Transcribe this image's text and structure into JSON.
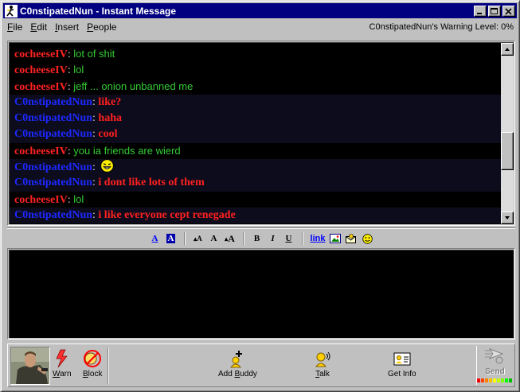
{
  "window": {
    "title": "C0nstipatedNun - Instant Message",
    "colors": {
      "titlebar": "#000080",
      "self_name": "#1e28ff",
      "other_name": "#ff2222",
      "other_text": "#33cc33",
      "self_text": "#ff2020"
    }
  },
  "menu": {
    "items": [
      {
        "label": "File",
        "key": "F",
        "rest": "ile"
      },
      {
        "label": "Edit",
        "key": "E",
        "rest": "dit"
      },
      {
        "label": "Insert",
        "key": "I",
        "rest": "nsert"
      },
      {
        "label": "People",
        "key": "P",
        "rest": "eople"
      }
    ],
    "warning": "C0nstipatedNun's Warning Level: 0%"
  },
  "chat": {
    "colon": ":",
    "messages": [
      {
        "sender": "cocheeseIV",
        "self": false,
        "text": "lot of shit"
      },
      {
        "sender": "cocheeseIV",
        "self": false,
        "text": "lol"
      },
      {
        "sender": "cocheeseIV",
        "self": false,
        "text": "jeff ... onion unbanned me"
      },
      {
        "sender": "C0nstipatedNun",
        "self": true,
        "text": "like?"
      },
      {
        "sender": "C0nstipatedNun",
        "self": true,
        "text": "haha"
      },
      {
        "sender": "C0nstipatedNun",
        "self": true,
        "text": "cool"
      },
      {
        "sender": "cocheeseIV",
        "self": false,
        "text": "you ia friends are wierd"
      },
      {
        "sender": "C0nstipatedNun",
        "self": true,
        "text": "",
        "icon": "grin-smiley-icon"
      },
      {
        "sender": "C0nstipatedNun",
        "self": true,
        "text": "i dont like lots of them"
      },
      {
        "sender": "cocheeseIV",
        "self": false,
        "text": "lol"
      },
      {
        "sender": "C0nstipatedNun",
        "self": true,
        "text": "i like everyone cept renegade"
      }
    ]
  },
  "format_toolbar": {
    "text_color": "A",
    "bg_color": "A",
    "smaller": "A",
    "normal": "A",
    "larger": "A",
    "bold": "B",
    "italic": "I",
    "underline": "U",
    "link": "link"
  },
  "bottom": {
    "warn": {
      "key": "W",
      "rest": "arn"
    },
    "block": {
      "key": "B",
      "rest": "lock"
    },
    "add_buddy": {
      "pre": "Add ",
      "key": "B",
      "rest": "uddy"
    },
    "talk": {
      "key": "T",
      "rest": "alk"
    },
    "get_info": "Get Info",
    "send": "Send"
  }
}
